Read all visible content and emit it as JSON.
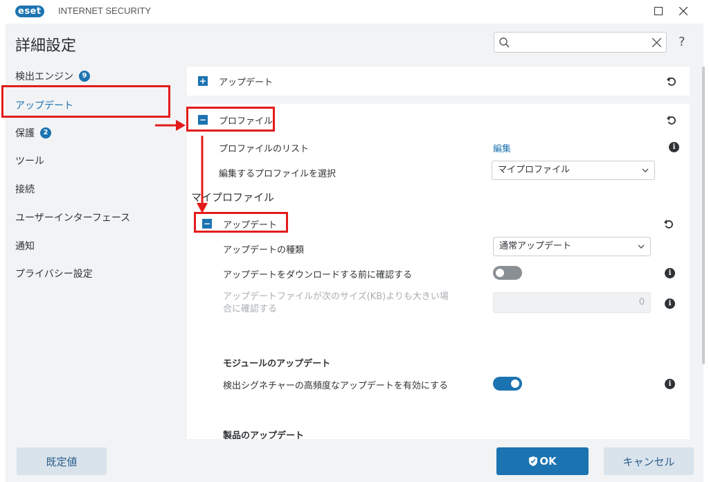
{
  "app": {
    "logo_text": "eset",
    "product_name": "INTERNET SECURITY",
    "page_title": "詳細設定"
  },
  "search": {
    "placeholder": ""
  },
  "help_label": "?",
  "sidebar": {
    "items": [
      {
        "label": "検出エンジン",
        "badge": "9"
      },
      {
        "label": "アップデート"
      },
      {
        "label": "保護",
        "badge": "2"
      },
      {
        "label": "ツール"
      },
      {
        "label": "接続"
      },
      {
        "label": "ユーザーインターフェース"
      },
      {
        "label": "通知"
      },
      {
        "label": "プライバシー設定"
      }
    ]
  },
  "content": {
    "update_section": {
      "label": "アップデート"
    },
    "profile_section": {
      "label": "プロファイル",
      "list_label": "プロファイルのリスト",
      "edit_link": "編集",
      "select_label": "編集するプロファイルを選択",
      "select_value": "マイプロファイル"
    },
    "my_profile_heading": "マイプロファイル",
    "update_subsection": {
      "label": "アップデート",
      "type_label": "アップデートの種類",
      "type_value": "通常アップデート",
      "confirm_download_label": "アップデートをダウンロードする前に確認する",
      "confirm_download_on": false,
      "size_confirm_label": "アップデートファイルが次のサイズ(KB)よりも大きい場合に確認する",
      "size_value": "0"
    },
    "module_updates": {
      "heading": "モジュールのアップデート",
      "frequent_label": "検出シグネチャーの高頻度なアップデートを有効にする",
      "frequent_on": true
    },
    "product_updates": {
      "heading": "製品のアップデート"
    }
  },
  "footer": {
    "default_label": "既定値",
    "ok_label": "OK",
    "cancel_label": "キャンセル"
  },
  "colors": {
    "accent": "#1c73b1",
    "highlight": "#e31b1b",
    "toggle_off": "#8a8f94"
  }
}
